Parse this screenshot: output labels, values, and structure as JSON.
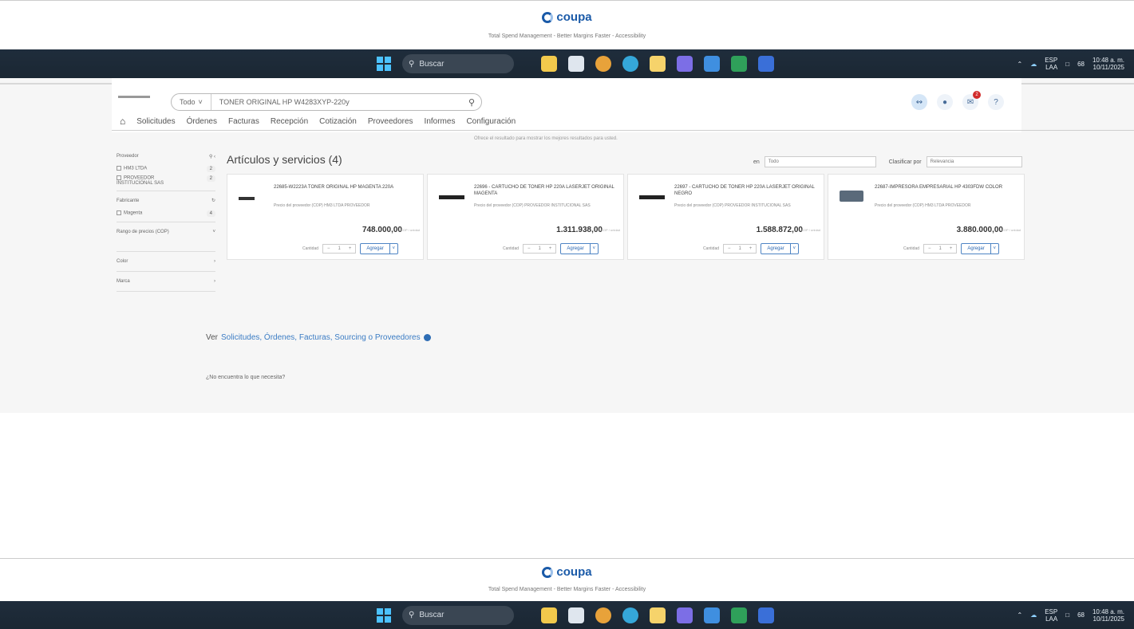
{
  "coupa_footer": {
    "logo_text": "coupa",
    "subtitle_top": "Total Spend Management - Better Margins Faster - Accessibility",
    "subtitle_bottom": "Total Spend Management - Better Margins Faster - Accessibility"
  },
  "taskbar": {
    "search_placeholder": "Buscar",
    "lang_top": "ESP",
    "lang_bottom": "LAA",
    "battery": "68",
    "time": "10:48 a. m.",
    "date": "10/11/2025"
  },
  "header": {
    "search_scope": "Todo",
    "search_query": "TONER ORIGINAL HP W4283XYP-220y",
    "notification_count": "2"
  },
  "nav": {
    "items": [
      "Solicitudes",
      "Órdenes",
      "Facturas",
      "Recepción",
      "Cotización",
      "Proveedores",
      "Informes",
      "Configuración"
    ]
  },
  "notice": "Ofrece el resultado para mostrar los mejores resultados para usted.",
  "sidebar": {
    "providers_label": "Proveedor",
    "providers": [
      {
        "name": "HM3 LTDA",
        "count": "2"
      },
      {
        "name": "PROVEEDOR INSTITUCIONAL SAS",
        "count": "2"
      }
    ],
    "manufacturer_label": "Fabricante",
    "manufacturers": [
      {
        "name": "Magenta",
        "count": "4"
      }
    ],
    "price_range_label": "Rango de precios (COP)",
    "color_label": "Color",
    "brand_label": "Marca"
  },
  "main": {
    "title": "Artículos y servicios (4)",
    "in_label": "en",
    "in_value": "Todo",
    "sort_label": "Clasificar por",
    "sort_value": "Relevancia",
    "cards": [
      {
        "title": "22685-W2223A TONER ORIGINAL HP MAGENTA 220A",
        "supplier": "Precio del proveedor (COP) HM3 LTDA PROVEEDOR",
        "price": "748.000,00",
        "unit": "COP / unidad",
        "qty_label": "Cantidad",
        "qty": "1",
        "add_label": "Agregar"
      },
      {
        "title": "22696 - CARTUCHO DE TONER HP 220A LASERJET ORIGINAL MAGENTA",
        "supplier": "Precio del proveedor (COP) PROVEEDOR INSTITUCIONAL SAS",
        "price": "1.311.938,00",
        "unit": "COP / unidad",
        "qty_label": "Cantidad",
        "qty": "1",
        "add_label": "Agregar"
      },
      {
        "title": "22697 - CARTUCHO DE TONER HP 220A LASERJET ORIGINAL NEGRO",
        "supplier": "Precio del proveedor (COP) PROVEEDOR INSTITUCIONAL SAS",
        "price": "1.588.872,00",
        "unit": "COP / unidad",
        "qty_label": "Cantidad",
        "qty": "1",
        "add_label": "Agregar"
      },
      {
        "title": "22687-IMPRESORA EMPRESARIAL HP 4303FDW COLOR",
        "supplier": "Precio del proveedor (COP) HM3 LTDA PROVEEDOR",
        "price": "3.880.000,00",
        "unit": "COP / unidad",
        "qty_label": "Cantidad",
        "qty": "1",
        "add_label": "Agregar"
      }
    ],
    "view_prefix": "Ver",
    "view_links": "Solicitudes, Órdenes, Facturas, Sourcing o Proveedores",
    "not_found": "¿No encuentra lo que necesita?"
  },
  "colors": {
    "taskbar_bg": "#1f2d3c",
    "coupa_blue": "#1a5aa8",
    "link_blue": "#3b7cc4",
    "badge_red": "#d12b2b"
  }
}
